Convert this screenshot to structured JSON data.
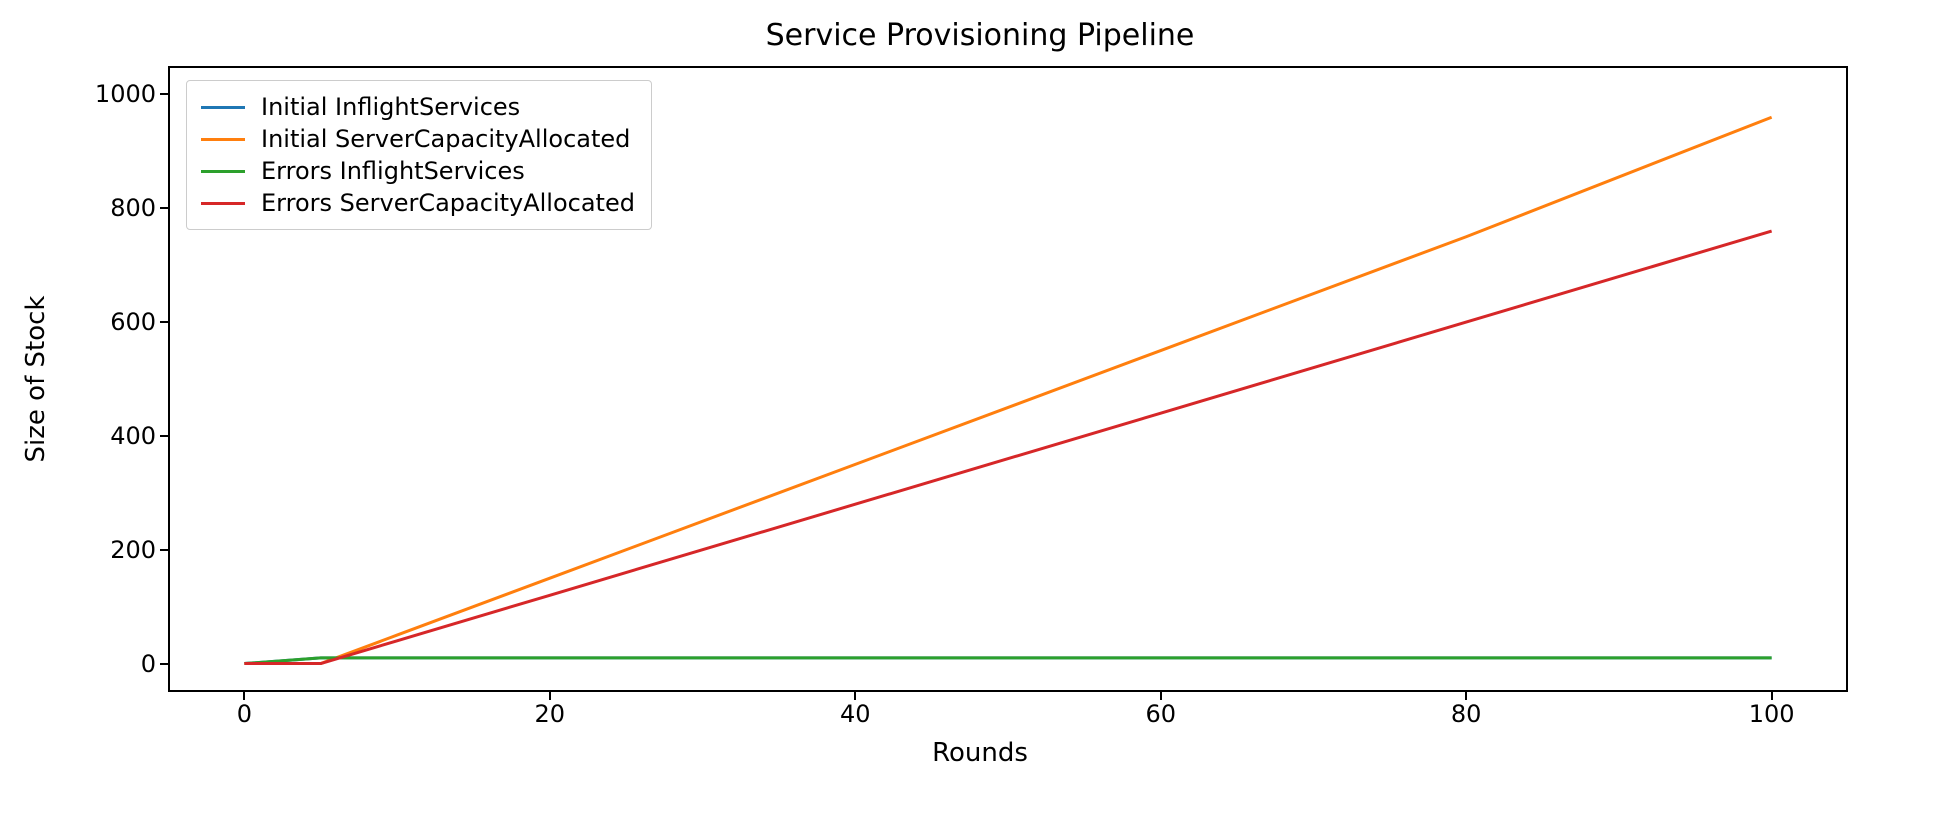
{
  "chart_data": {
    "type": "line",
    "title": "Service Provisioning Pipeline",
    "xlabel": "Rounds",
    "ylabel": "Size of Stock",
    "xlim": [
      -5,
      105
    ],
    "ylim": [
      -50,
      1050
    ],
    "xticks": [
      0,
      20,
      40,
      60,
      80,
      100
    ],
    "yticks": [
      0,
      200,
      400,
      600,
      800,
      1000
    ],
    "legend_position": "upper left",
    "series": [
      {
        "name": "Initial InflightServices",
        "color": "#1f77b4",
        "x": [
          0,
          5,
          10,
          20,
          40,
          60,
          80,
          100
        ],
        "y": [
          0,
          10,
          10,
          10,
          10,
          10,
          10,
          10
        ]
      },
      {
        "name": "Initial ServerCapacityAllocated",
        "color": "#ff7f0e",
        "x": [
          0,
          5,
          10,
          20,
          40,
          60,
          80,
          100
        ],
        "y": [
          0,
          0,
          50,
          150,
          350,
          550,
          750,
          960
        ]
      },
      {
        "name": "Errors InflightServices",
        "color": "#2ca02c",
        "x": [
          0,
          5,
          10,
          20,
          40,
          60,
          80,
          100
        ],
        "y": [
          0,
          10,
          10,
          10,
          10,
          10,
          10,
          10
        ]
      },
      {
        "name": "Errors ServerCapacityAllocated",
        "color": "#d62728",
        "x": [
          0,
          5,
          10,
          20,
          40,
          60,
          80,
          100
        ],
        "y": [
          0,
          0,
          40,
          120,
          280,
          440,
          600,
          760
        ]
      }
    ]
  }
}
